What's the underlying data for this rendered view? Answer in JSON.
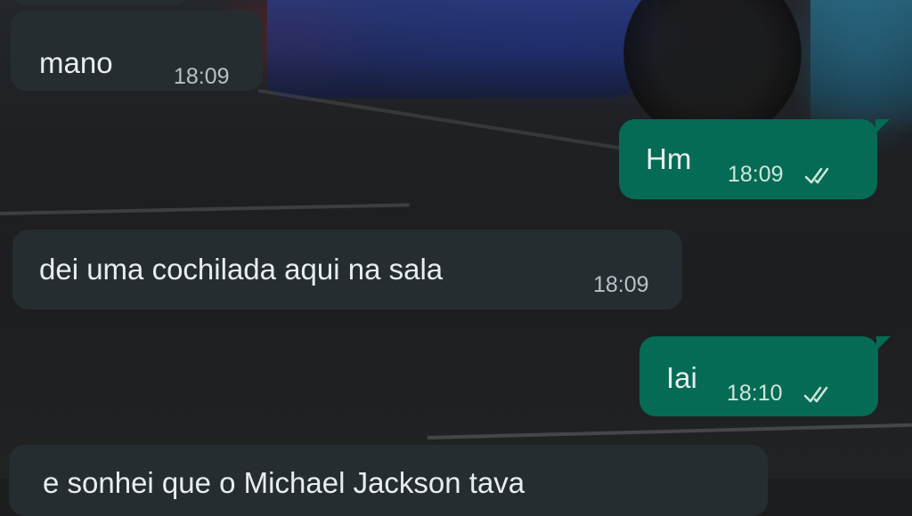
{
  "messages": [
    {
      "direction": "incoming",
      "text": "",
      "time": ""
    },
    {
      "direction": "incoming",
      "text": "mano",
      "time": "18:09"
    },
    {
      "direction": "outgoing",
      "text": "Hm",
      "time": "18:09",
      "status_icon": "double-check-icon"
    },
    {
      "direction": "incoming",
      "text": "dei uma cochilada aqui na sala",
      "time": "18:09"
    },
    {
      "direction": "outgoing",
      "text": "Iai",
      "time": "18:10",
      "status_icon": "double-check-icon"
    },
    {
      "direction": "incoming",
      "text": "e sonhei que o Michael Jackson tava",
      "time": ""
    }
  ],
  "colors": {
    "incoming_bubble": "#262d31",
    "outgoing_bubble": "#056b54",
    "text": "#e9edef"
  }
}
